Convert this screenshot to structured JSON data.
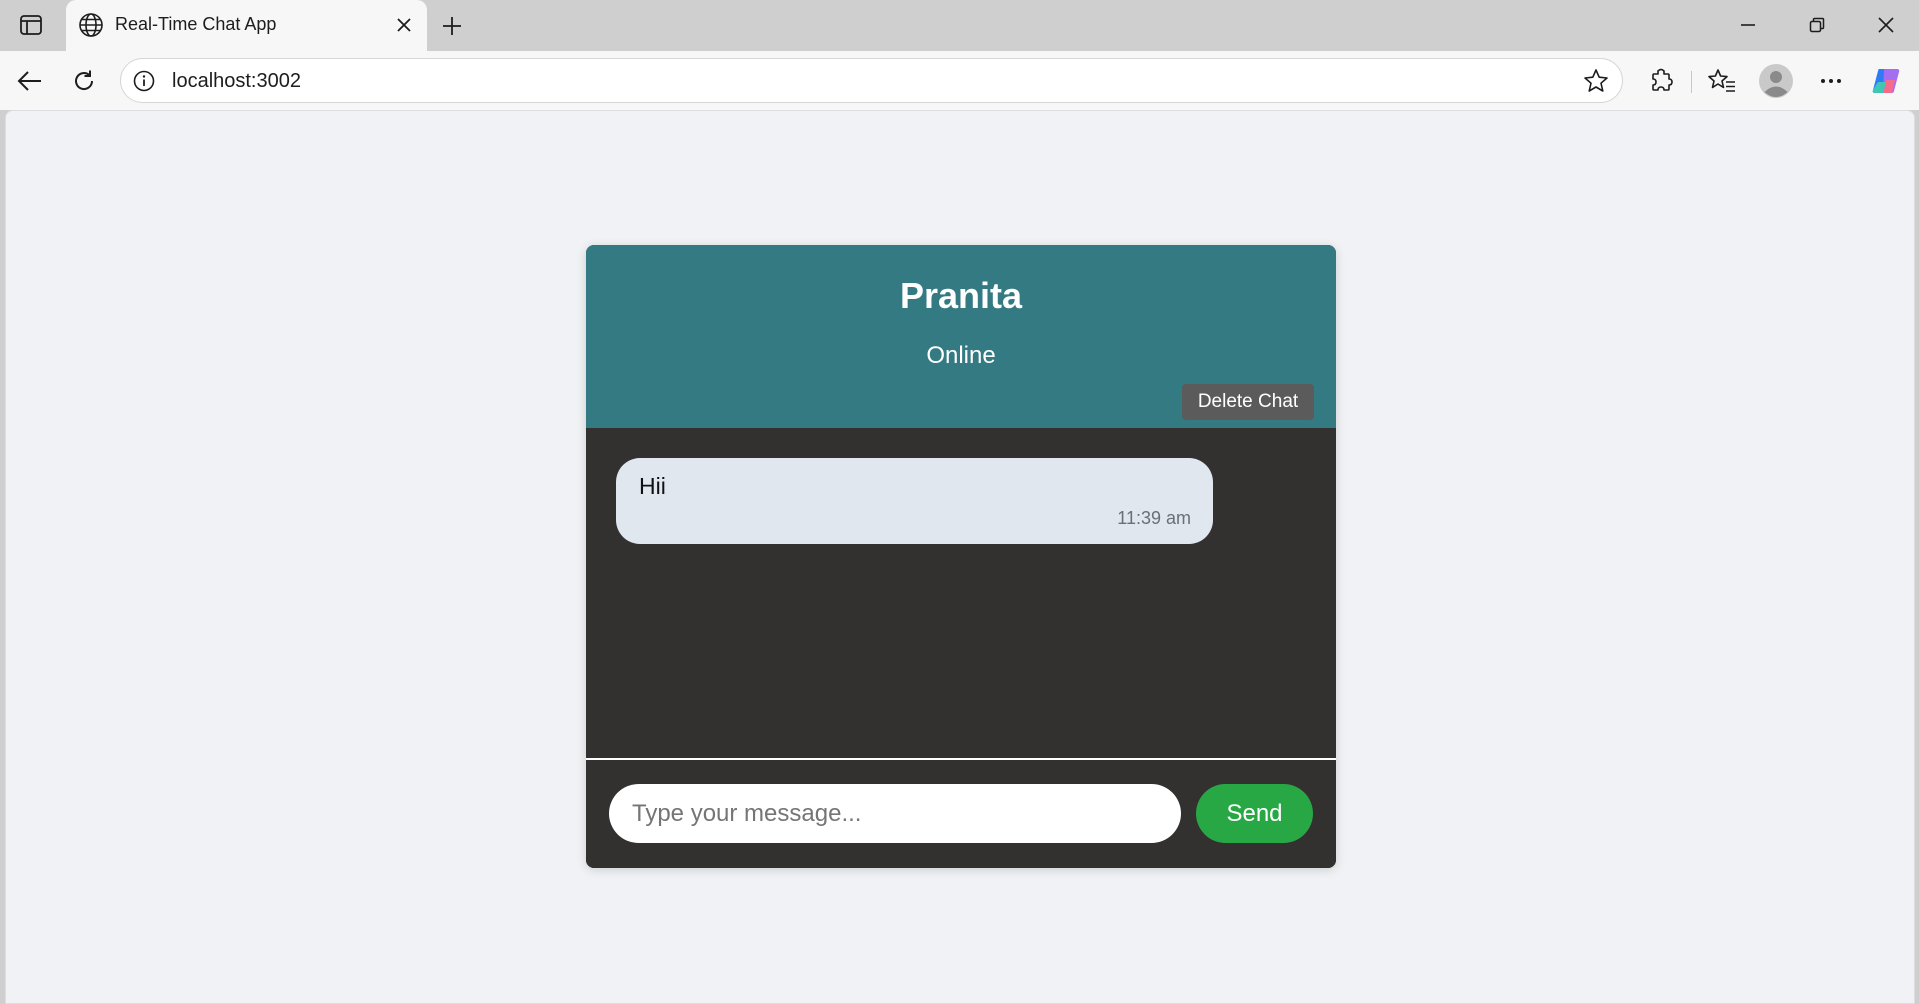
{
  "browser": {
    "tab": {
      "title": "Real-Time Chat App",
      "icon": "globe-icon"
    },
    "address": {
      "url": "localhost:3002"
    },
    "icons": {
      "tab_actions": "tab-actions-icon",
      "close_tab": "close-icon",
      "new_tab": "plus-icon",
      "minimize": "minimize-icon",
      "restore": "restore-icon",
      "close_window": "close-window-icon",
      "back": "back-arrow-icon",
      "reload": "reload-icon",
      "site_info": "info-icon",
      "favorite": "star-icon",
      "extensions": "extensions-icon",
      "favorites": "favorites-icon",
      "profile": "avatar-icon",
      "more": "more-icon",
      "copilot": "copilot-icon"
    }
  },
  "chat": {
    "header": {
      "name": "Pranita",
      "status": "Online",
      "delete_label": "Delete Chat"
    },
    "messages": [
      {
        "text": "Hii",
        "time": "11:39 am"
      }
    ],
    "composer": {
      "placeholder": "Type your message...",
      "send_label": "Send"
    }
  },
  "colors": {
    "header_bg": "#347a82",
    "body_bg": "#333030",
    "bubble_bg": "#e0e7ef",
    "send_bg": "#28a745",
    "delete_bg": "#5b5b5b",
    "page_bg": "#f0f2f5"
  }
}
